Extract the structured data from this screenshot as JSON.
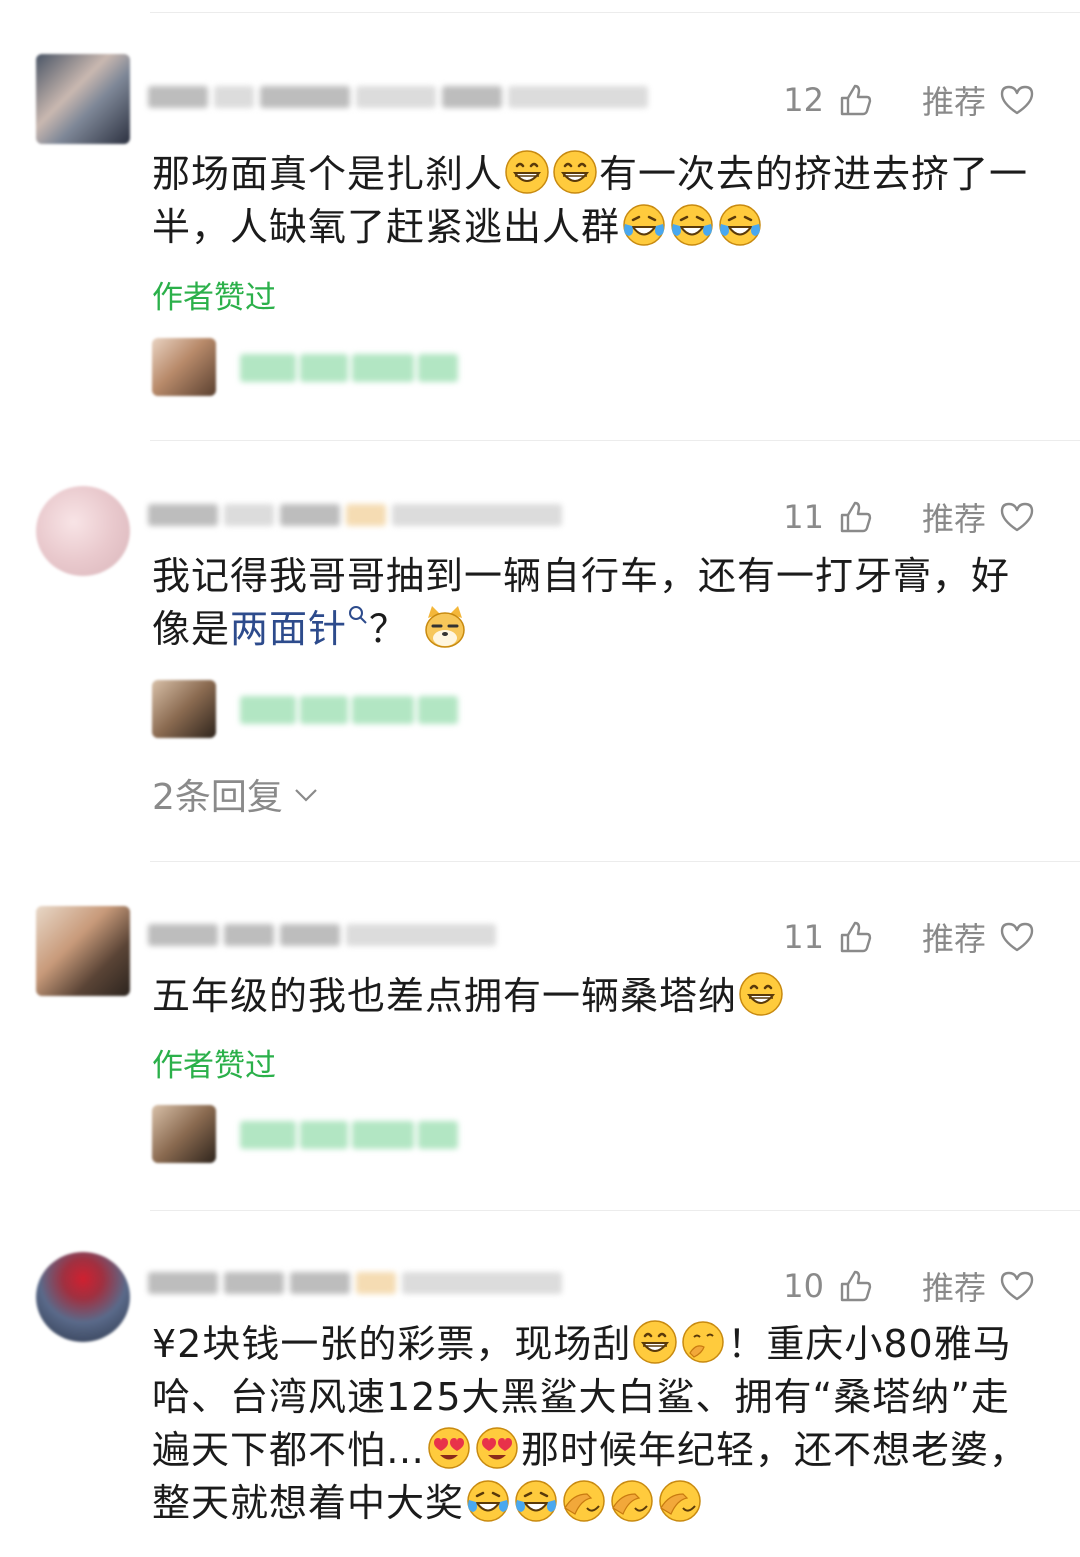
{
  "comments": [
    {
      "likes": "12",
      "recommend_label": "推荐",
      "text_parts": [
        "那场面真个是扎刹人",
        "有一次去的挤进去挤了一半，人缺氧了赶紧逃出人群"
      ],
      "badge": "作者赞过"
    },
    {
      "likes": "11",
      "recommend_label": "推荐",
      "text_before_link": "我记得我哥哥抽到一辆自行车，还有一打牙膏，好像是",
      "link_text": "两面针",
      "text_after_link": "？",
      "more_replies": "2条回复"
    },
    {
      "likes": "11",
      "recommend_label": "推荐",
      "text": "五年级的我也差点拥有一辆桑塔纳",
      "badge": "作者赞过"
    },
    {
      "likes": "10",
      "recommend_label": "推荐",
      "text_parts": [
        "¥2块钱一张的彩票，现场刮",
        "！重庆小80雅马哈、台湾风速125大黑鲨大白鲨、拥有“桑塔纳”走遍天下都不怕…",
        "那时候年纪轻，还不想老婆，整天就想着中大奖"
      ]
    }
  ],
  "colors": {
    "text": "#1b1b1b",
    "meta": "#8a8a8a",
    "liked_badge": "#2bb04a",
    "link": "#2d4b8c"
  },
  "icons": [
    "thumb-up-icon",
    "heart-icon",
    "search-icon",
    "chevron-down-icon",
    "grin-emoji-icon",
    "laugh-cry-emoji-icon",
    "doge-emoji-icon",
    "heart-eyes-emoji-icon",
    "facepalm-emoji-icon",
    "shy-emoji-icon"
  ]
}
